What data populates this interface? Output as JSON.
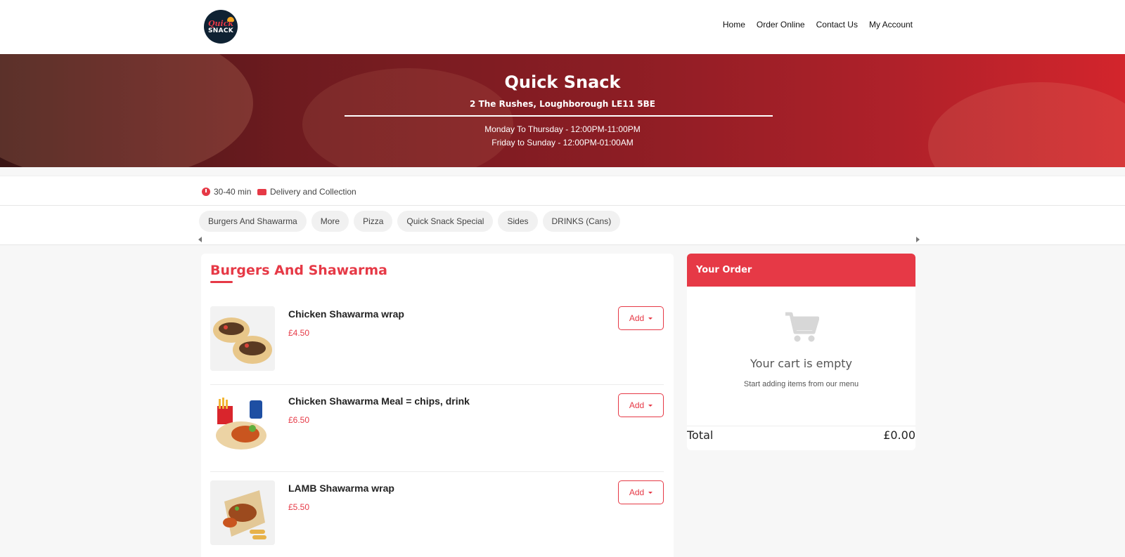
{
  "header": {
    "logo_text_top": "Quick",
    "logo_text_bottom": "SNACK",
    "nav": [
      "Home",
      "Order Online",
      "Contact Us",
      "My Account"
    ]
  },
  "hero": {
    "title": "Quick Snack",
    "address": "2 The Rushes, Loughborough LE11 5BE",
    "hours": [
      "Monday To Thursday - 12:00PM-11:00PM",
      "Friday to Sunday - 12:00PM-01:00AM"
    ]
  },
  "info": {
    "time": "30-40 min",
    "service": "Delivery and Collection"
  },
  "categories": [
    "Burgers And Shawarma",
    "More",
    "Pizza",
    "Quick Snack Special",
    "Sides",
    "DRINKS (Cans)"
  ],
  "menu": {
    "section_title": "Burgers And Shawarma",
    "add_label": "Add",
    "items": [
      {
        "name": "Chicken Shawarma wrap",
        "price": "£4.50"
      },
      {
        "name": "Chicken Shawarma Meal = chips, drink",
        "price": "£6.50"
      },
      {
        "name": "LAMB Shawarma wrap",
        "price": "£5.50"
      }
    ]
  },
  "order": {
    "title": "Your Order",
    "empty_title": "Your cart is empty",
    "empty_sub": "Start adding items from our menu",
    "total_label": "Total",
    "total_value": "£0.00"
  },
  "colors": {
    "accent": "#e63946"
  }
}
